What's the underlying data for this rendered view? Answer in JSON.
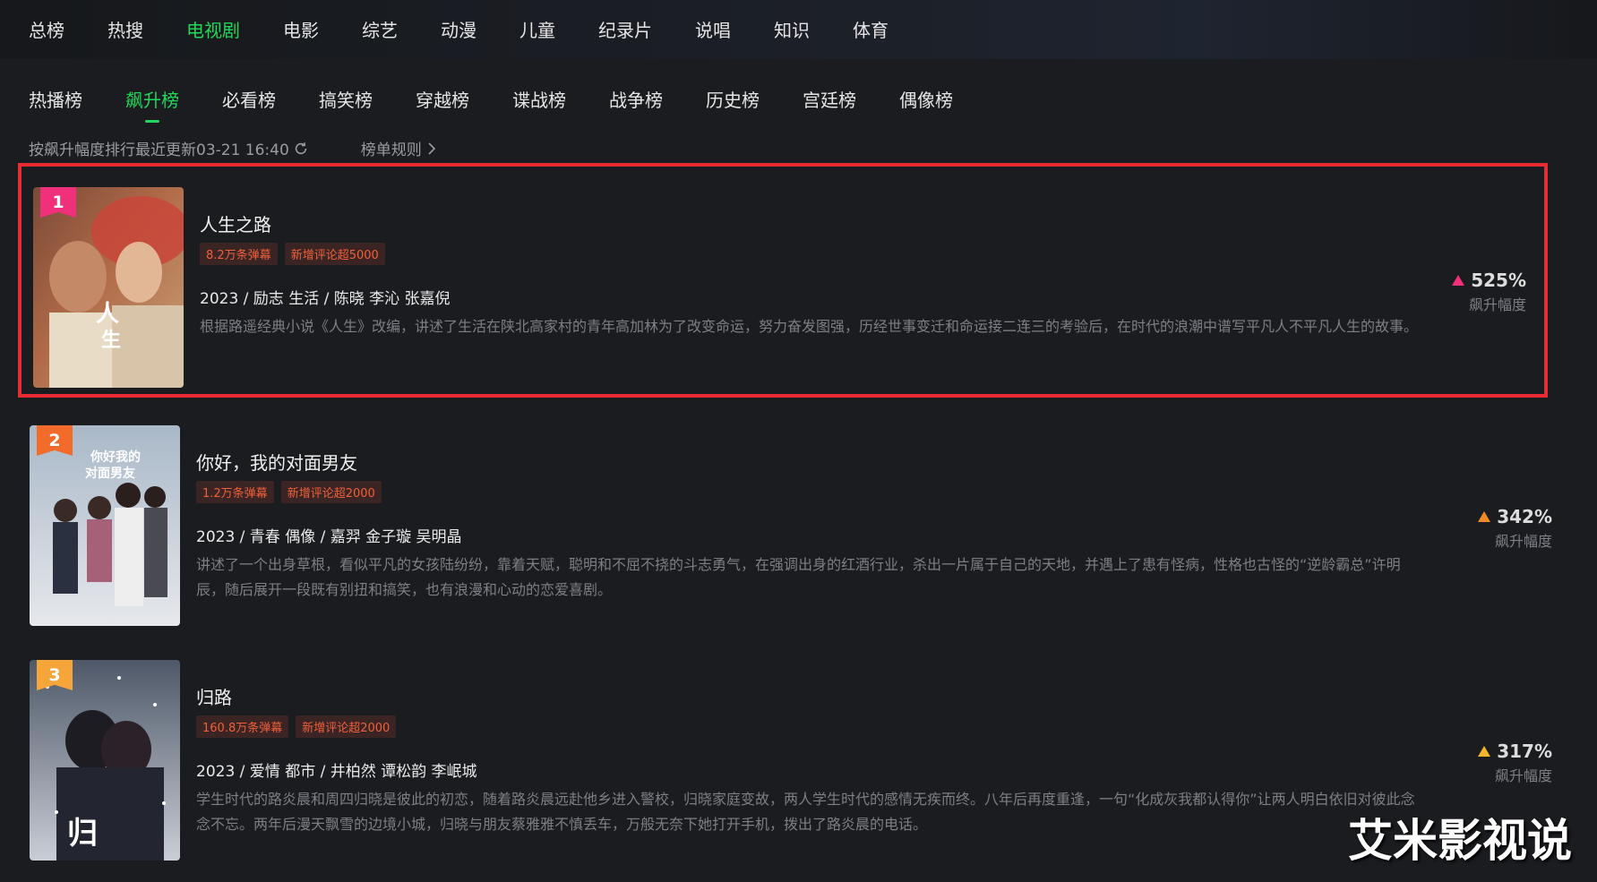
{
  "top_nav": [
    "总榜",
    "热搜",
    "电视剧",
    "电影",
    "综艺",
    "动漫",
    "儿童",
    "纪录片",
    "说唱",
    "知识",
    "体育"
  ],
  "top_nav_active": "电视剧",
  "sub_nav": [
    "热播榜",
    "飙升榜",
    "必看榜",
    "搞笑榜",
    "穿越榜",
    "谍战榜",
    "战争榜",
    "历史榜",
    "宫廷榜",
    "偶像榜"
  ],
  "sub_nav_active": "飙升榜",
  "meta": {
    "sort_text": "按飙升幅度排行最近更新03-21 16:40",
    "rules_label": "榜单规则"
  },
  "items": [
    {
      "rank": "1",
      "title": "人生之路",
      "tags": [
        "8.2万条弹幕",
        "新增评论超5000"
      ],
      "info": "2023 / 励志 生活 / 陈晓 李沁 张嘉倪",
      "desc": "根据路遥经典小说《人生》改编，讲述了生活在陕北高家村的青年高加林为了改变命运，努力奋发图强，历经世事变迁和命运接二连三的考验后，在时代的浪潮中谱写平凡人不平凡人生的故事。",
      "growth": "525%",
      "growth_label": "飙升幅度",
      "rank_color": "#f0307a",
      "arrow_color": "#f0307a"
    },
    {
      "rank": "2",
      "title": "你好，我的对面男友",
      "tags": [
        "1.2万条弹幕",
        "新增评论超2000"
      ],
      "info": "2023 / 青春 偶像 / 嘉羿 金子璇 吴明晶",
      "desc": "讲述了一个出身草根，看似平凡的女孩陆纷纷，靠着天赋，聪明和不屈不挠的斗志勇气，在强调出身的红酒行业，杀出一片属于自己的天地，并遇上了患有怪病，性格也古怪的“逆龄霸总”许明辰，随后展开一段既有别扭和搞笑，也有浪漫和心动的恋爱喜剧。",
      "growth": "342%",
      "growth_label": "飙升幅度",
      "rank_color": "#f26b2a",
      "arrow_color": "#f08a28"
    },
    {
      "rank": "3",
      "title": "归路",
      "tags": [
        "160.8万条弹幕",
        "新增评论超2000"
      ],
      "info": "2023 / 爱情 都市 / 井柏然 谭松韵 李岷城",
      "desc": "学生时代的路炎晨和周四归晓是彼此的初恋，随着路炎晨远赴他乡进入警校，归晓家庭变故，两人学生时代的感情无疾而终。八年后再度重逢，一句“化成灰我都认得你”让两人明白依旧对彼此念念不忘。两年后漫天飘雪的边境小城，归晓与朋友蔡雅雅不慎丢车，万般无奈下她打开手机，拨出了路炎晨的电话。",
      "growth": "317%",
      "growth_label": "飙升幅度",
      "rank_color": "#f5a53a",
      "arrow_color": "#f5b52a"
    }
  ],
  "watermark": "艾米影视说"
}
